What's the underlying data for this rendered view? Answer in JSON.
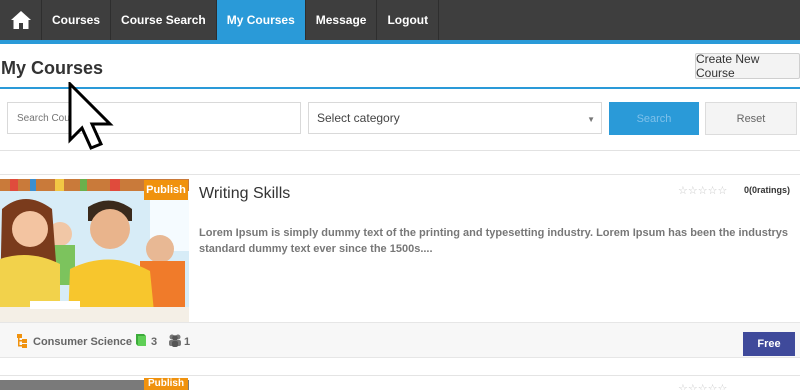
{
  "nav": {
    "home_icon": "home-icon",
    "items": [
      "Courses",
      "Course Search",
      "My Courses",
      "Message",
      "Logout"
    ],
    "active": "My Courses"
  },
  "header": {
    "title": "My Courses",
    "create_button": "Create New Course"
  },
  "filters": {
    "search_placeholder": "Search Course",
    "category_value": "Select category",
    "search_button": "Search",
    "reset_button": "Reset"
  },
  "courses": [
    {
      "status": "Publish",
      "title": "Writing Skills",
      "rating_count": "0(0ratings)",
      "description": "Lorem Ipsum is simply dummy text of the printing and typesetting industry. Lorem Ipsum has been the industrys standard dummy text ever since the 1500s....",
      "category": "Consumer Science",
      "lessons": "3",
      "students": "1",
      "price": "Free"
    },
    {
      "status": "Publish"
    }
  ],
  "colors": {
    "nav_bg": "#3e3e3e",
    "accent_blue": "#2a9ad8",
    "publish_orange": "#f0920e",
    "price_indigo": "#3f4a9b"
  }
}
